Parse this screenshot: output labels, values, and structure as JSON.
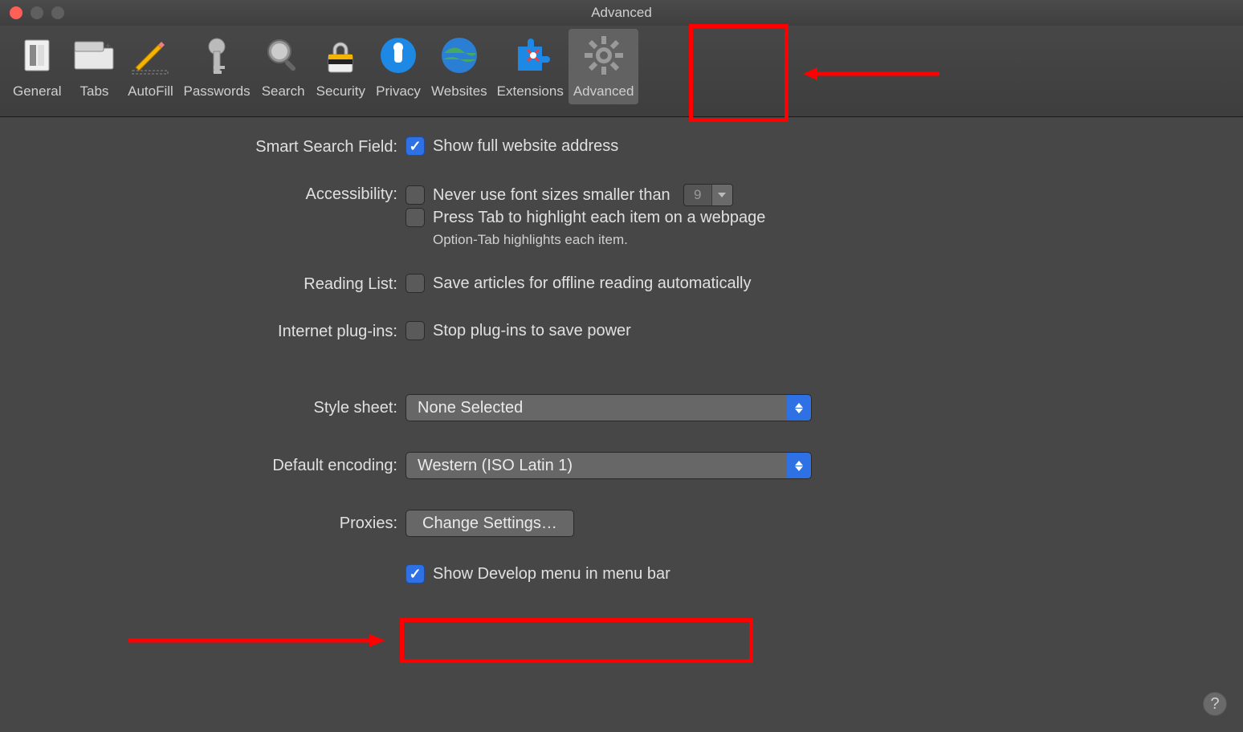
{
  "window": {
    "title": "Advanced"
  },
  "toolbar": {
    "items": [
      {
        "id": "general",
        "label": "General"
      },
      {
        "id": "tabs",
        "label": "Tabs"
      },
      {
        "id": "autofill",
        "label": "AutoFill"
      },
      {
        "id": "passwords",
        "label": "Passwords"
      },
      {
        "id": "search",
        "label": "Search"
      },
      {
        "id": "security",
        "label": "Security"
      },
      {
        "id": "privacy",
        "label": "Privacy"
      },
      {
        "id": "websites",
        "label": "Websites"
      },
      {
        "id": "extensions",
        "label": "Extensions"
      },
      {
        "id": "advanced",
        "label": "Advanced",
        "selected": true
      }
    ]
  },
  "sections": {
    "smart_search": {
      "label": "Smart Search Field:",
      "show_full_address": {
        "text": "Show full website address",
        "checked": true
      }
    },
    "accessibility": {
      "label": "Accessibility:",
      "min_font": {
        "text": "Never use font sizes smaller than",
        "checked": false,
        "value": "9"
      },
      "press_tab": {
        "text": "Press Tab to highlight each item on a webpage",
        "checked": false
      },
      "hint": "Option-Tab highlights each item."
    },
    "reading_list": {
      "label": "Reading List:",
      "save_offline": {
        "text": "Save articles for offline reading automatically",
        "checked": false
      }
    },
    "plugins": {
      "label": "Internet plug-ins:",
      "stop_plugins": {
        "text": "Stop plug-ins to save power",
        "checked": false
      }
    },
    "style_sheet": {
      "label": "Style sheet:",
      "value": "None Selected"
    },
    "default_encoding": {
      "label": "Default encoding:",
      "value": "Western (ISO Latin 1)"
    },
    "proxies": {
      "label": "Proxies:",
      "button": "Change Settings…"
    },
    "develop": {
      "text": "Show Develop menu in menu bar",
      "checked": true
    }
  },
  "help_tooltip": "?"
}
